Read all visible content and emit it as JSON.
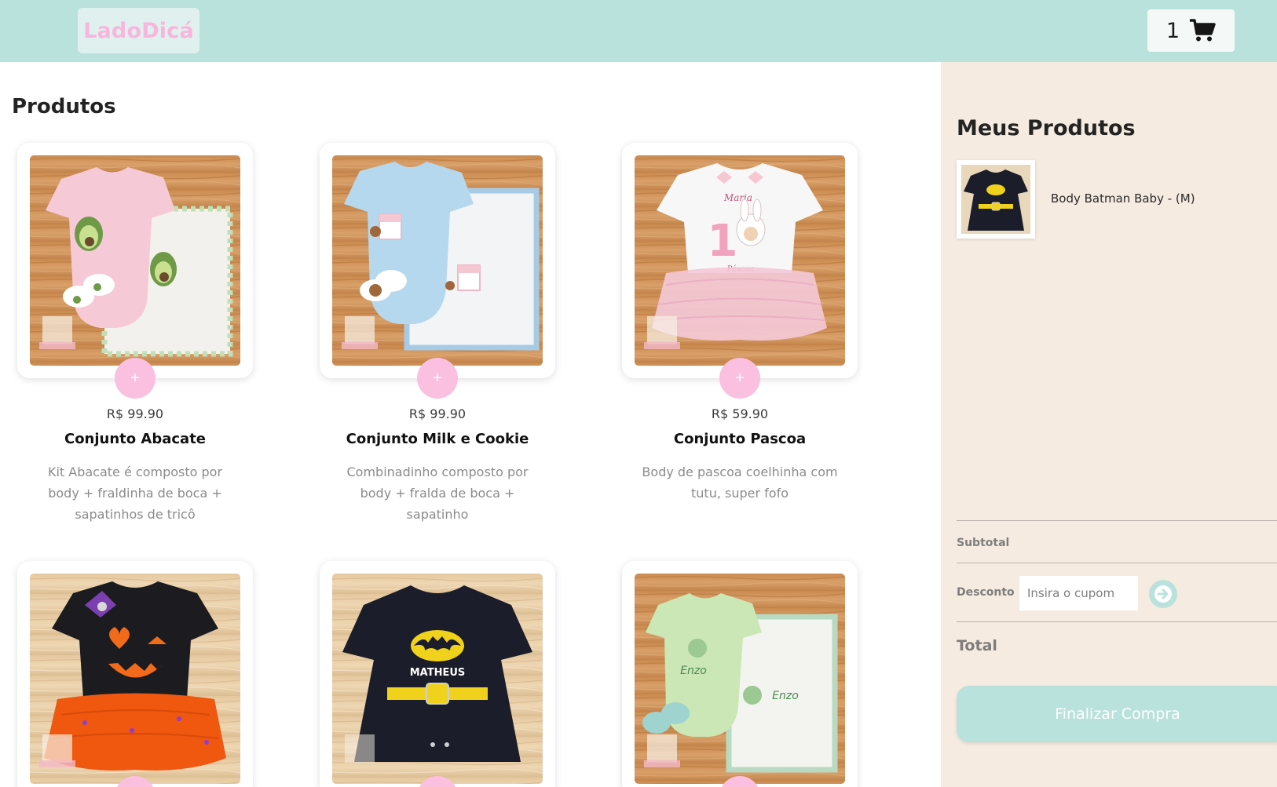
{
  "header": {
    "logo_text": "LadoDicá",
    "cart_count": "1",
    "cart_icon": "shopping-cart-icon"
  },
  "products": {
    "title": "Produtos",
    "add_label": "+",
    "items": [
      {
        "price": "R$ 99.90",
        "name": "Conjunto Abacate",
        "description": "Kit Abacate é composto por body + fraldinha de boca + sapatinhos de tricô"
      },
      {
        "price": "R$ 99.90",
        "name": "Conjunto Milk e Cookie",
        "description": "Combinadinho composto por body + fralda de boca + sapatinho"
      },
      {
        "price": "R$ 59.90",
        "name": "Conjunto Pascoa",
        "description": "Body de pascoa coelhinha com tutu, super fofo"
      },
      {
        "price": "",
        "name": "",
        "description": ""
      },
      {
        "price": "",
        "name": "",
        "description": ""
      },
      {
        "price": "",
        "name": "",
        "description": ""
      }
    ],
    "image_texts": {
      "watermark": "Lado Dicá",
      "pascoa_name": "Maria",
      "pascoa_number": "1",
      "pascoa_word": "Páscoa",
      "batman_name": "MATHEUS",
      "enzo_name": "Enzo"
    }
  },
  "cart": {
    "title": "Meus Produtos",
    "items": [
      {
        "name": "Body Batman Baby - (M)"
      }
    ],
    "subtotal_label": "Subtotal",
    "discount_label": "Desconto",
    "coupon_placeholder": "Insira o cupom",
    "total_label": "Total",
    "checkout_label": "Finalizar Compra"
  },
  "colors": {
    "header_bg": "#b9e2dd",
    "logo_pink": "#f7b6dc",
    "add_button_pink": "#fbbfe0",
    "sidebar_bg": "#f6ebe0",
    "accent_teal": "#b9e2dd"
  }
}
